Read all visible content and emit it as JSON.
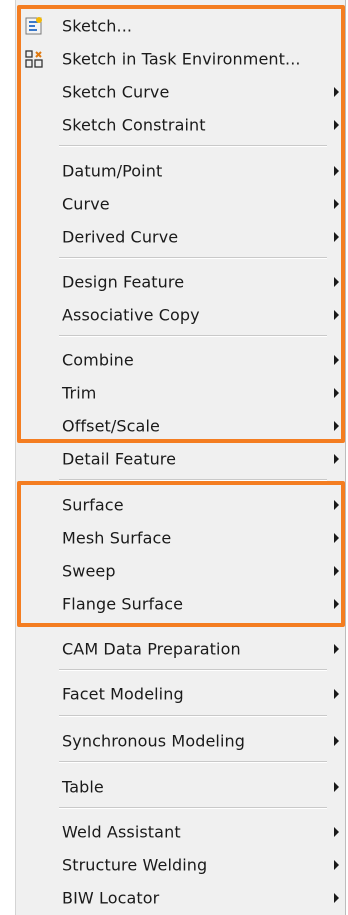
{
  "menu": {
    "items": [
      {
        "label": "Sketch...",
        "icon": "sketch-icon"
      },
      {
        "label": "Sketch in Task Environment...",
        "icon": "sketch-task-environment-icon"
      },
      {
        "label": "Sketch Curve"
      },
      {
        "label": "Sketch Constraint"
      },
      {
        "label": "Datum/Point"
      },
      {
        "label": "Curve"
      },
      {
        "label": "Derived Curve"
      },
      {
        "label": "Design Feature"
      },
      {
        "label": "Associative Copy"
      },
      {
        "label": "Combine"
      },
      {
        "label": "Trim"
      },
      {
        "label": "Offset/Scale"
      },
      {
        "label": "Detail Feature"
      },
      {
        "label": "Surface"
      },
      {
        "label": "Mesh Surface"
      },
      {
        "label": "Sweep"
      },
      {
        "label": "Flange Surface"
      },
      {
        "label": "CAM Data Preparation"
      },
      {
        "label": "Facet Modeling"
      },
      {
        "label": "Synchronous Modeling"
      },
      {
        "label": "Table"
      },
      {
        "label": "Weld Assistant"
      },
      {
        "label": "Structure Welding"
      },
      {
        "label": "BIW Locator"
      }
    ]
  },
  "colors": {
    "highlight_outline": "#f47d21",
    "menu_background": "#f0f0f0"
  }
}
